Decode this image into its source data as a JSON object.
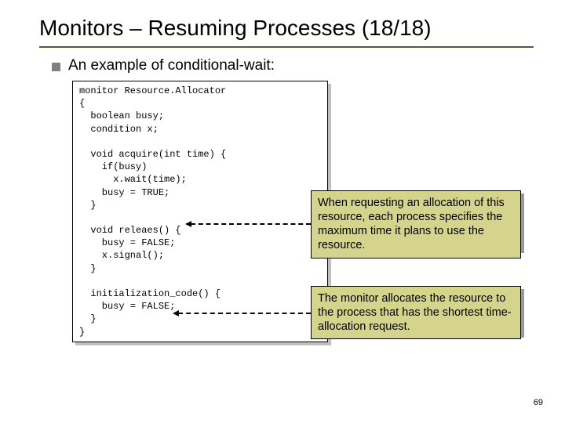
{
  "title": "Monitors – Resuming Processes (18/18)",
  "bullet": "An example of conditional-wait:",
  "code": "monitor Resource.Allocator\n{\n  boolean busy;\n  condition x;\n\n  void acquire(int time) {\n    if(busy)\n      x.wait(time);\n    busy = TRUE;\n  }\n\n  void releaes() {\n    busy = FALSE;\n    x.signal();\n  }\n\n  initialization_code() {\n    busy = FALSE;\n  }\n}",
  "callout1": "When requesting an allocation of this resource, each process specifies the maximum time it plans to use the resource.",
  "callout2": "The monitor allocates the resource to the process that has the shortest time-allocation request.",
  "pagenum": "69"
}
